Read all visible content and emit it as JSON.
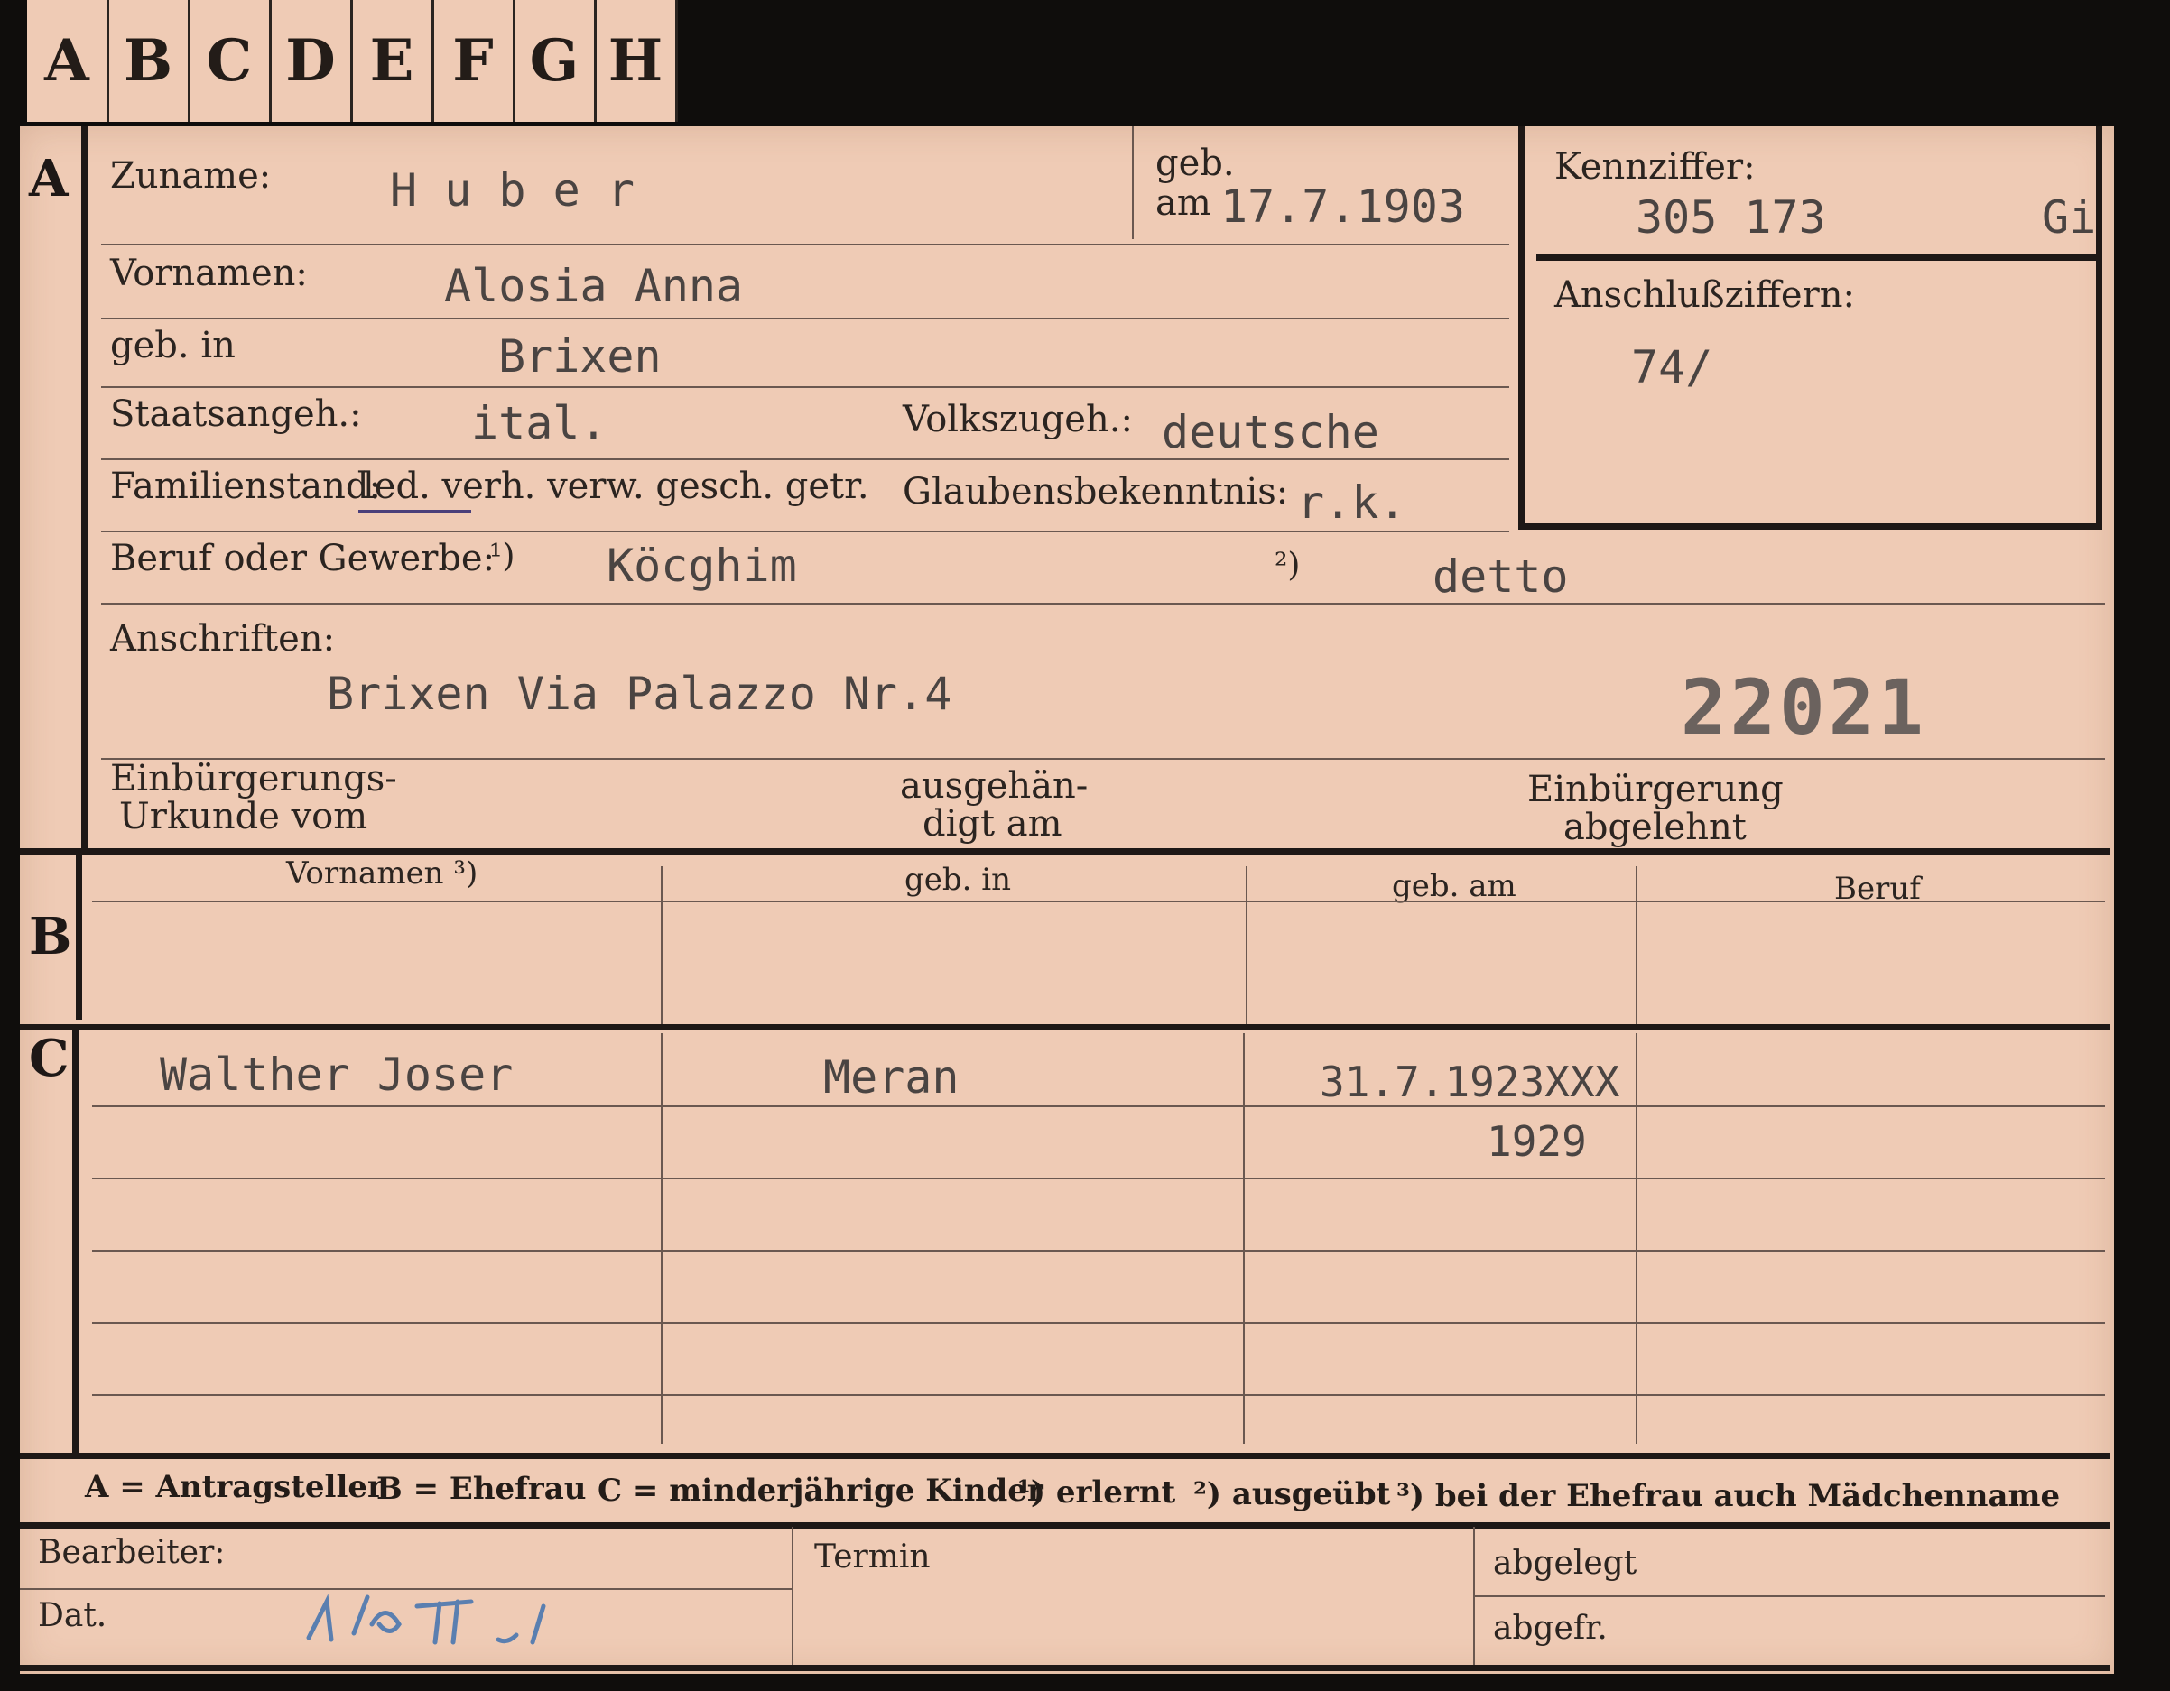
{
  "tabs": [
    "A",
    "B",
    "C",
    "D",
    "E",
    "F",
    "G",
    "H"
  ],
  "section_a": {
    "letter": "A",
    "zuname_label": "Zuname:",
    "zuname_value": "H u b e r",
    "geb_label": "geb.",
    "am_label": "am",
    "geb_am_value": "17.7.1903",
    "vornamen_label": "Vornamen:",
    "vornamen_value": "Alosia Anna",
    "geb_in_label": "geb. in",
    "geb_in_value": "Brixen",
    "staatsangeh_label": "Staatsangeh.:",
    "staatsangeh_value": "ital.",
    "volkszugeh_label": "Volkszugeh.:",
    "volkszugeh_value": "deutsche",
    "familienstand_label": "Familienstand:",
    "familienstand_options": "led. verh. verw. gesch. getr.",
    "glaubens_label": "Glaubensbekenntnis:",
    "glaubens_value": "r.k.",
    "beruf_label": "Beruf oder Gewerbe:",
    "beruf_note1": "¹)",
    "beruf_value1": "Köcghim",
    "beruf_note2": "²)",
    "beruf_value2": "detto",
    "anschriften_label": "Anschriften:",
    "anschriften_value": "Brixen Via Palazzo  Nr.4",
    "stamp_number": "22021",
    "einbuergerung_label1": "Einbürgerungs-",
    "einbuergerung_label2": "Urkunde vom",
    "ausgehaendigt_label1": "ausgehän-",
    "ausgehaendigt_label2": "digt am",
    "abgelehnt_label1": "Einbürgerung",
    "abgelehnt_label2": "abgelehnt"
  },
  "kennziffer": {
    "label": "Kennziffer:",
    "value": "305 173",
    "suffix": "Gi",
    "anschluss_label": "Anschlußziffern:",
    "anschluss_value": "74/"
  },
  "section_b": {
    "letter": "B",
    "columns": [
      "Vornamen ³)",
      "geb. in",
      "geb. am",
      "Beruf"
    ]
  },
  "section_c": {
    "letter": "C",
    "row1": {
      "name": "Walther Joser",
      "place": "Meran",
      "date": "31.7.1923XXX",
      "date_correction": "1929"
    }
  },
  "footer": {
    "legend_a": "A = Antragsteller",
    "legend_b": "B = Ehefrau",
    "legend_c": "C = minderjährige Kinder",
    "legend_1": "¹) erlernt",
    "legend_2": "²) ausgeübt",
    "legend_3": "³) bei der Ehefrau auch Mädchenname",
    "bearbeiter_label": "Bearbeiter:",
    "dat_label": "Dat.",
    "termin_label": "Termin",
    "abgelegt_label": "abgelegt",
    "abgefr_label": "abgefr."
  },
  "colors": {
    "card": "#efcbb5",
    "ink": "#2a2420",
    "typewriter": "#4a4442",
    "pencil": "#5a7fb0",
    "underline": "#4a3f7a"
  }
}
